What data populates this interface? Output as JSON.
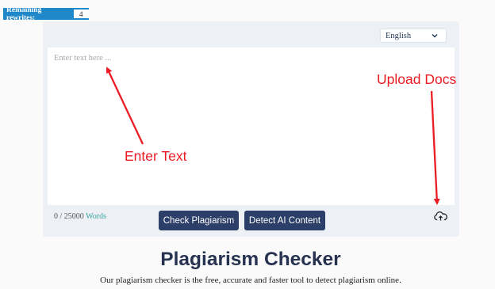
{
  "badge": {
    "label": "Remaining rewrites:",
    "count": "4"
  },
  "language": {
    "selected": "English"
  },
  "editor": {
    "placeholder": "Enter text here ..."
  },
  "word_count": {
    "current": "0 / 25000",
    "unit": "Words"
  },
  "buttons": {
    "check": "Check Plagiarism",
    "detect": "Detect AI Content"
  },
  "page": {
    "title": "Plagiarism Checker",
    "description": "Our plagiarism checker is the free, accurate and faster tool to detect plagiarism online."
  },
  "annotations": {
    "enter_text": "Enter Text",
    "upload_docs": "Upload Docs"
  },
  "colors": {
    "badge": "#1e88c8",
    "button": "#2c3f68",
    "annotation": "#ec1c24",
    "panel": "#edf1f6",
    "title": "#26324f"
  },
  "icons": {
    "language_dropdown": "chevron-down-icon",
    "upload": "cloud-upload-icon"
  }
}
